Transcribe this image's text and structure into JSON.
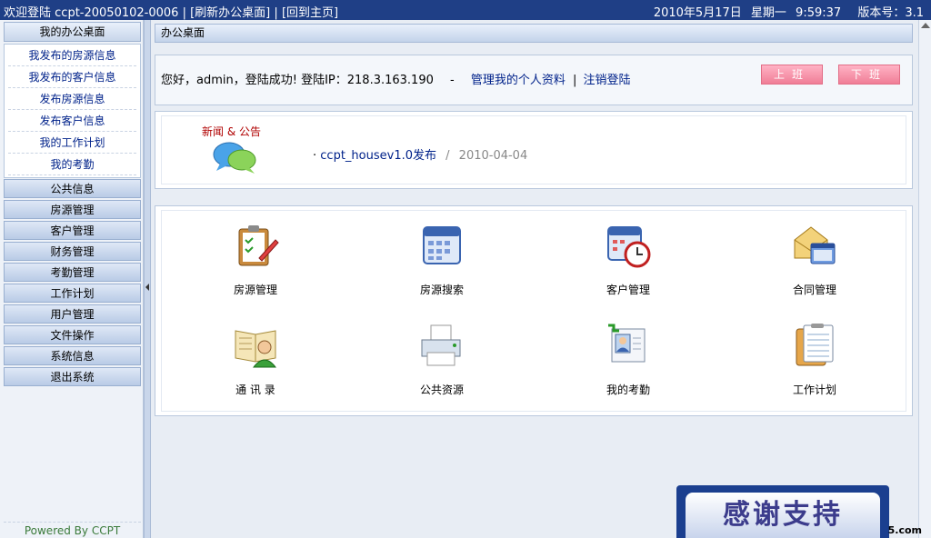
{
  "topbar": {
    "welcome": "欢迎登陆",
    "company": "ccpt-20050102-0006",
    "sep1": "|",
    "refresh_link": "[刷新办公桌面]",
    "sep2": "|",
    "home_link": "[回到主页]",
    "date": "2010年5月17日",
    "weekday": "星期一",
    "time": "9:59:37",
    "version": "版本号：3.1"
  },
  "sidebar": {
    "header": "我的办公桌面",
    "sub_items": [
      "我发布的房源信息",
      "我发布的客户信息",
      "发布房源信息",
      "发布客户信息",
      "我的工作计划",
      "我的考勤"
    ],
    "menu": [
      "公共信息",
      "房源管理",
      "客户管理",
      "财务管理",
      "考勤管理",
      "工作计划",
      "用户管理",
      "文件操作",
      "系统信息",
      "退出系统"
    ],
    "footer": "Powered By CCPT"
  },
  "main": {
    "title": "办公桌面",
    "welcome_text": "您好，admin，登陆成功! 登陆IP：218.3.163.190",
    "dash": "-",
    "profile_link": "管理我的个人资料",
    "pipe": "|",
    "logout_link": "注销登陆",
    "btn_on": "上班",
    "btn_off": "下班",
    "news_title": "新闻 & 公告",
    "news_bullet": "·",
    "news_item": "ccpt_housev1.0发布",
    "news_sep": "/",
    "news_date": "2010-04-04",
    "grid": [
      "房源管理",
      "房源搜索",
      "客户管理",
      "合同管理",
      "通 讯 录",
      "公共资源",
      "我的考勤",
      "工作计划"
    ]
  },
  "banner": {
    "text": "感谢支持",
    "corner": "5.com"
  },
  "colors": {
    "topbar": "#1f3f86",
    "link": "#00228a",
    "pink": "#f07e97",
    "news_title": "#b00000",
    "footer": "#3a7a3a"
  }
}
